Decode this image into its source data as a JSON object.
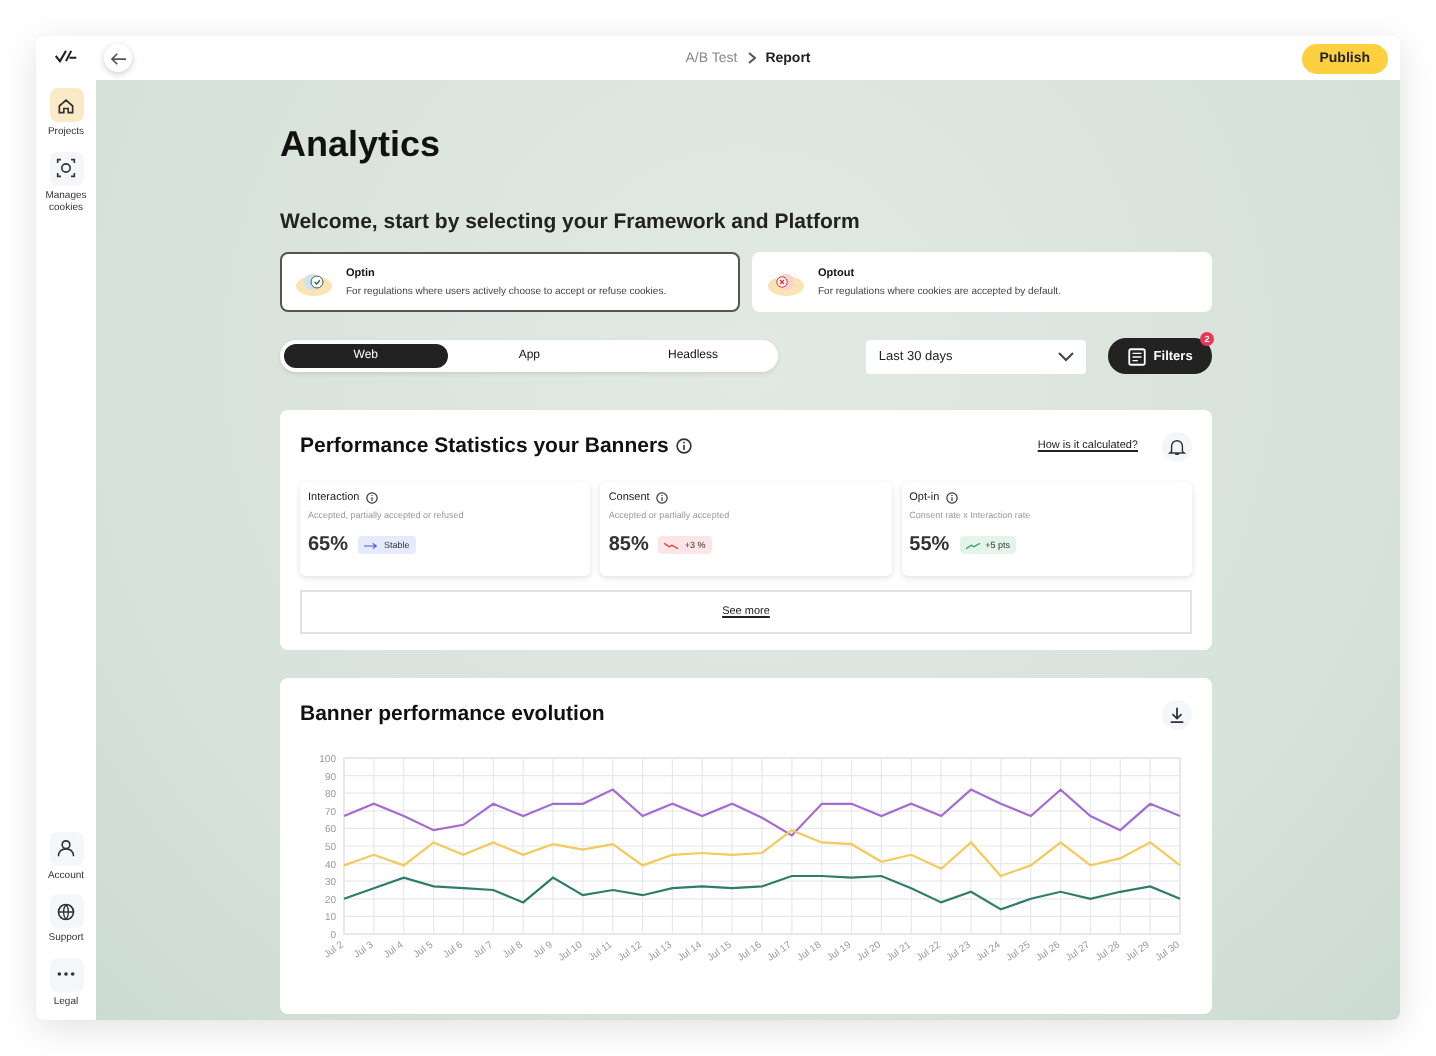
{
  "sidebar": {
    "items": [
      {
        "label": "Projects",
        "selected": true
      },
      {
        "label": "Manages cookies",
        "selected": false
      }
    ],
    "bottom_items": [
      {
        "label": "Account"
      },
      {
        "label": "Support"
      },
      {
        "label": "Legal"
      }
    ]
  },
  "topbar": {
    "breadcrumb": [
      "A/B Test",
      "Report"
    ],
    "publish_button": "Publish"
  },
  "page": {
    "title": "Analytics",
    "subtitle": "Welcome, start by selecting your Framework and Platform",
    "modes": [
      {
        "title": "Optin",
        "description": "For regulations where users actively choose to accept or refuse cookies.",
        "selected": true,
        "kind": "optin"
      },
      {
        "title": "Optout",
        "description": "For regulations where cookies are accepted by default.",
        "selected": false,
        "kind": "optout"
      }
    ],
    "platform_tabs": [
      {
        "label": "Web",
        "selected": true
      },
      {
        "label": "App",
        "selected": false
      },
      {
        "label": "Headless",
        "selected": false
      }
    ],
    "period_select": {
      "value": "Last 30 days"
    },
    "filters_button": {
      "label": "Filters",
      "count": "2"
    }
  },
  "performance": {
    "title": "Performance Statistics your Banners",
    "help_link": "How is it calculated?",
    "metrics": [
      {
        "name": "Interaction",
        "description": "Accepted, partially accepted or refused",
        "value": "65%",
        "trend": "Stable",
        "kind": "flat"
      },
      {
        "name": "Consent",
        "description": "Accepted or partially accepted",
        "value": "85%",
        "trend": "+3 %",
        "kind": "down"
      },
      {
        "name": "Opt-in",
        "description": "Consent rate x Interaction rate",
        "value": "55%",
        "trend": "+5 pts",
        "kind": "up"
      }
    ],
    "see_more": "See more"
  },
  "evolution": {
    "title": "Banner performance evolution",
    "chart_data": {
      "type": "line",
      "categories": [
        "Jul 2",
        "Jul 3",
        "Jul 4",
        "Jul 5",
        "Jul 6",
        "Jul 7",
        "Jul 8",
        "Jul 9",
        "Jul 10",
        "Jul 11",
        "Jul 12",
        "Jul 13",
        "Jul 14",
        "Jul 15",
        "Jul 16",
        "Jul 17",
        "Jul 18",
        "Jul 19",
        "Jul 20",
        "Jul 21",
        "Jul 22",
        "Jul 23",
        "Jul 24",
        "Jul 25",
        "Jul 26",
        "Jul 27",
        "Jul 28",
        "Jul 29",
        "Jul 30"
      ],
      "ylim": [
        0,
        100
      ],
      "grid": true,
      "yticks": [
        0,
        10,
        20,
        30,
        40,
        50,
        60,
        70,
        80,
        90,
        100
      ],
      "series": [
        {
          "color": "#a36bd4",
          "values": [
            67,
            74,
            67,
            59,
            62,
            74,
            67,
            74,
            74,
            82,
            67,
            74,
            67,
            74,
            66,
            56,
            74,
            74,
            67,
            74,
            67,
            82,
            74,
            67,
            82,
            67,
            59,
            74,
            67
          ]
        },
        {
          "color": "#f5c95a",
          "values": [
            39,
            45,
            39,
            52,
            45,
            52,
            45,
            51,
            48,
            51,
            39,
            45,
            46,
            45,
            46,
            59,
            52,
            51,
            41,
            45,
            37,
            52,
            33,
            39,
            52,
            39,
            43,
            52,
            39
          ]
        },
        {
          "color": "#2e7d6b",
          "values": [
            20,
            26,
            32,
            27,
            26,
            25,
            18,
            32,
            22,
            25,
            22,
            26,
            27,
            26,
            27,
            33,
            33,
            32,
            33,
            26,
            18,
            24,
            14,
            20,
            24,
            20,
            24,
            27,
            20
          ]
        }
      ]
    }
  }
}
